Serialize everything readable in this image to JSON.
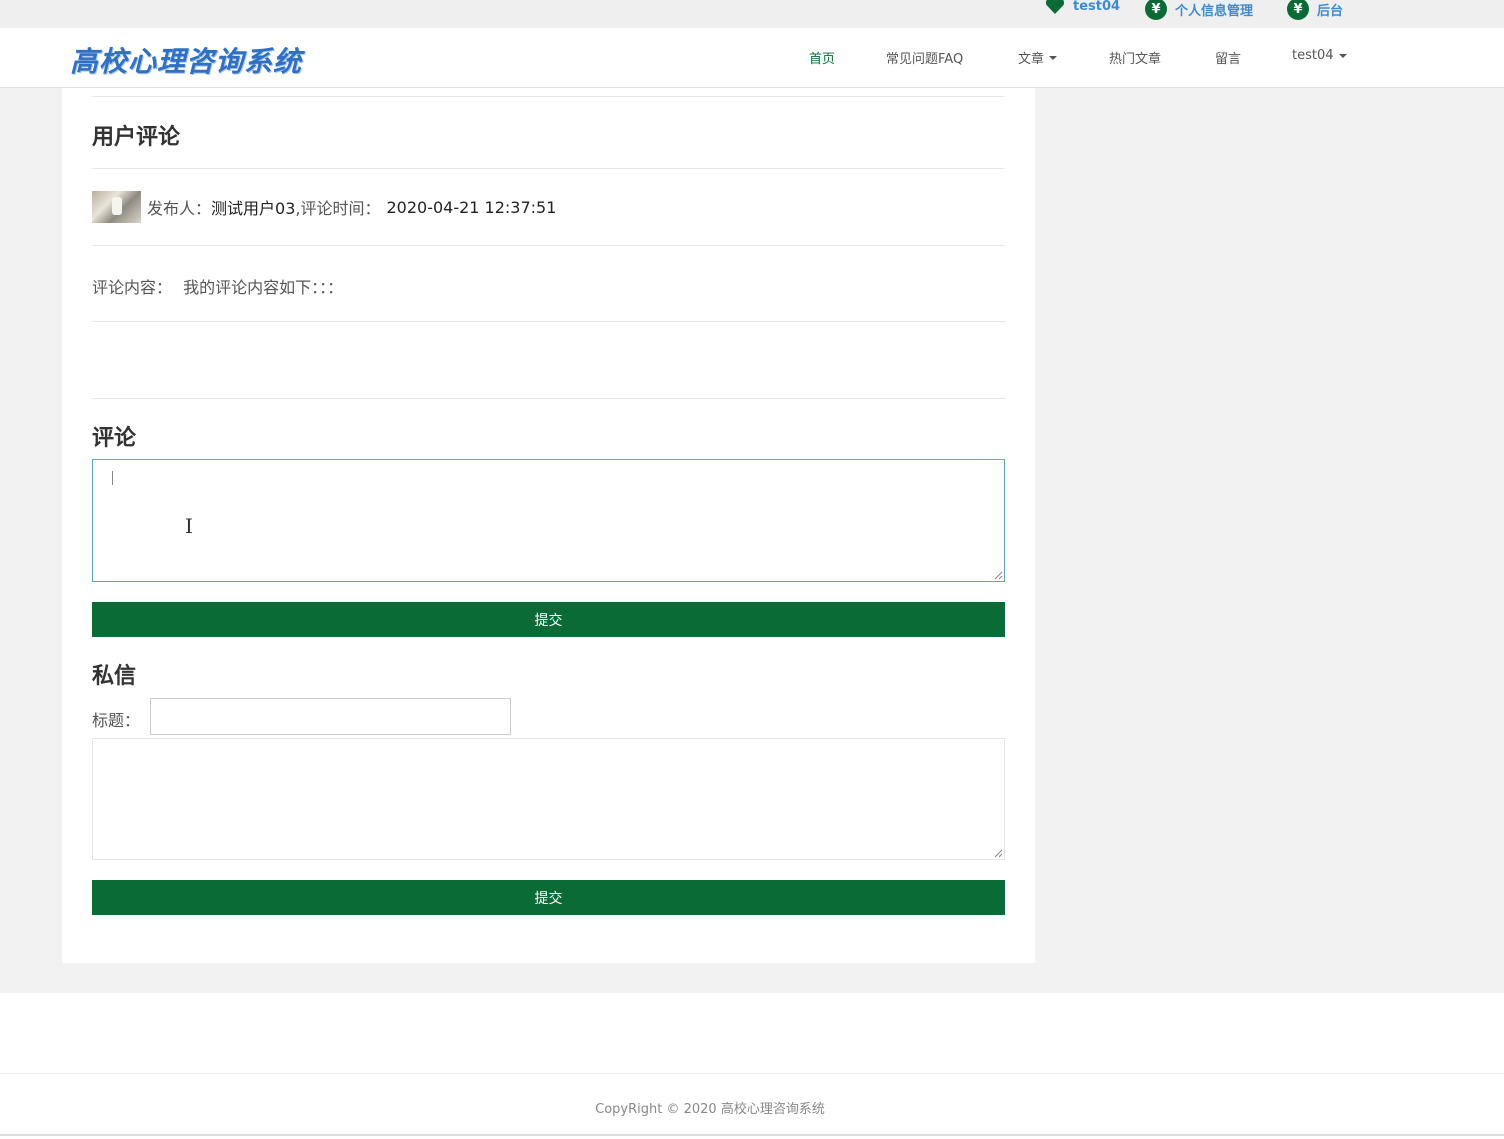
{
  "top_links": [
    {
      "label": "test04",
      "icon": "heart-icon"
    },
    {
      "label": "个人信息管理",
      "icon": "yen-icon"
    },
    {
      "label": "后台",
      "icon": "yen-icon"
    }
  ],
  "logo": "高校心理咨询系统",
  "nav": [
    {
      "label": "首页",
      "active": true
    },
    {
      "label": "常见问题FAQ"
    },
    {
      "label": "文章",
      "dropdown": true
    },
    {
      "label": "热门文章"
    },
    {
      "label": "留言"
    },
    {
      "label": "test04",
      "dropdown": true
    }
  ],
  "comments_section": {
    "heading": "用户评论",
    "publisher_label": "发布人：",
    "publisher": "测试用户03",
    "time_label": ",评论时间：",
    "time": "2020-04-21 12:37:51",
    "content_label": "评论内容：",
    "content": "我的评论内容如下：：："
  },
  "comment_form": {
    "heading": "评论",
    "textarea_value": "",
    "submit": "提交"
  },
  "message_form": {
    "heading": "私信",
    "title_label": "标题：",
    "title_value": "",
    "body_value": "",
    "submit": "提交"
  },
  "footer": {
    "copyright": "CopyRight © 2020 高校心理咨询系统"
  },
  "colors": {
    "primary": "#0a6b36",
    "link": "#3d8bd1",
    "logo": "#2f6fc4"
  }
}
